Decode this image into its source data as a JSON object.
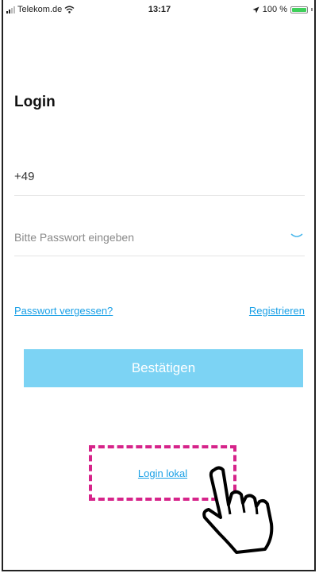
{
  "status_bar": {
    "carrier": "Telekom.de",
    "time": "13:17",
    "battery": "100 %"
  },
  "page": {
    "title": "Login"
  },
  "phone": {
    "prefix": "+49"
  },
  "password": {
    "placeholder": "Bitte Passwort eingeben"
  },
  "links": {
    "forgot_password": "Passwort vergessen?",
    "register": "Registrieren",
    "local_login": "Login lokal"
  },
  "actions": {
    "confirm_label": "Bestätigen"
  },
  "colors": {
    "accent": "#1aa0e6",
    "button": "#7cd3f4",
    "highlight": "#d6248a"
  },
  "icons": [
    "signal-icon",
    "wifi-icon",
    "location-arrow-icon",
    "battery-icon",
    "eye-closed-icon",
    "pointing-hand-icon"
  ]
}
